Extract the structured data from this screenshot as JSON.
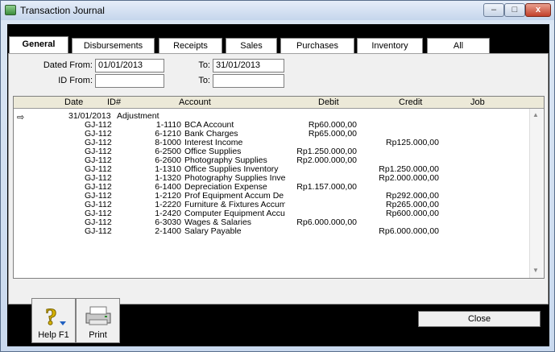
{
  "window": {
    "title": "Transaction Journal",
    "min": "–",
    "max": "□",
    "close": "x"
  },
  "tabs": [
    {
      "label": "General"
    },
    {
      "label": "Disbursements"
    },
    {
      "label": "Receipts"
    },
    {
      "label": "Sales"
    },
    {
      "label": "Purchases"
    },
    {
      "label": "Inventory"
    },
    {
      "label": "All"
    }
  ],
  "filters": {
    "dated_from_label": "Dated From:",
    "dated_from_value": "01/01/2013",
    "to_label": "To:",
    "to_value": "31/01/2013",
    "id_from_label": "ID From:",
    "id_from_value": "",
    "id_to_label": "To:",
    "id_to_value": ""
  },
  "grid": {
    "columns": [
      "Date",
      "ID#",
      "Account",
      "Debit",
      "Credit",
      "Job"
    ],
    "selected_marker": "⇨",
    "header_row": {
      "date": "31/01/2013",
      "memo": "Adjustment"
    },
    "rows": [
      {
        "id": "GJ-112",
        "acct": "1-1110",
        "name": "BCA Account",
        "debit": "Rp60.000,00",
        "credit": ""
      },
      {
        "id": "GJ-112",
        "acct": "6-1210",
        "name": "Bank Charges",
        "debit": "Rp65.000,00",
        "credit": ""
      },
      {
        "id": "GJ-112",
        "acct": "8-1000",
        "name": "Interest Income",
        "debit": "",
        "credit": "Rp125.000,00"
      },
      {
        "id": "GJ-112",
        "acct": "6-2500",
        "name": "Office Supplies",
        "debit": "Rp1.250.000,00",
        "credit": ""
      },
      {
        "id": "GJ-112",
        "acct": "6-2600",
        "name": "Photography Supplies",
        "debit": "Rp2.000.000,00",
        "credit": ""
      },
      {
        "id": "GJ-112",
        "acct": "1-1310",
        "name": "Office Supplies Inventory",
        "debit": "",
        "credit": "Rp1.250.000,00"
      },
      {
        "id": "GJ-112",
        "acct": "1-1320",
        "name": "Photography Supplies Inve",
        "debit": "",
        "credit": "Rp2.000.000,00"
      },
      {
        "id": "GJ-112",
        "acct": "6-1400",
        "name": "Depreciation Expense",
        "debit": "Rp1.157.000,00",
        "credit": ""
      },
      {
        "id": "GJ-112",
        "acct": "1-2120",
        "name": "Prof Equipment Accum De",
        "debit": "",
        "credit": "Rp292.000,00"
      },
      {
        "id": "GJ-112",
        "acct": "1-2220",
        "name": "Furniture & Fixtures Accum",
        "debit": "",
        "credit": "Rp265.000,00"
      },
      {
        "id": "GJ-112",
        "acct": "1-2420",
        "name": "Computer Equipment Accu",
        "debit": "",
        "credit": "Rp600.000,00"
      },
      {
        "id": "GJ-112",
        "acct": "6-3030",
        "name": "Wages & Salaries",
        "debit": "Rp6.000.000,00",
        "credit": ""
      },
      {
        "id": "GJ-112",
        "acct": "2-1400",
        "name": "Salary Payable",
        "debit": "",
        "credit": "Rp6.000.000,00"
      }
    ]
  },
  "buttons": {
    "help": "Help F1",
    "print": "Print",
    "close": "Close"
  }
}
